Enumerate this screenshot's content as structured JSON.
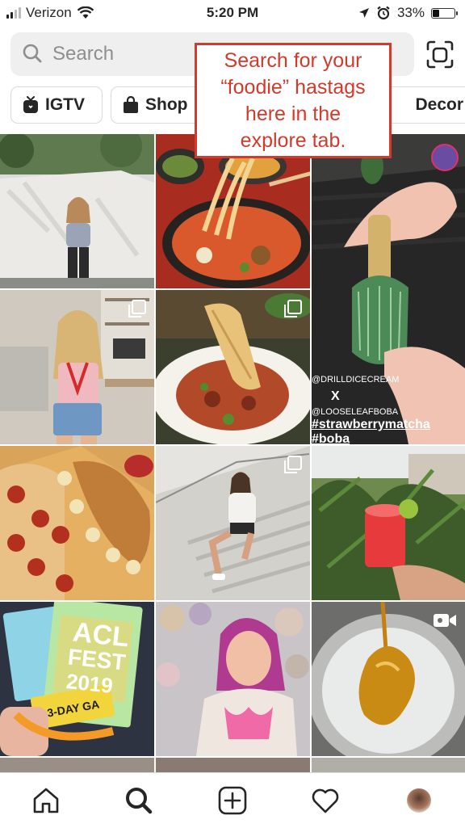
{
  "status_bar": {
    "carrier": "Verizon",
    "time": "5:20 PM",
    "battery": "33%",
    "battery_level": 0.33
  },
  "search": {
    "placeholder": "Search"
  },
  "chips": [
    {
      "label": "IGTV",
      "icon": "igtv-icon"
    },
    {
      "label": "Shop",
      "icon": "shopping-bag-icon"
    },
    {
      "label": "Decor"
    }
  ],
  "annotation": {
    "line1": "Search for your",
    "line2": "“foodie” hastags",
    "line3": "here in the",
    "line4": "explore tab."
  },
  "grid_posts": {
    "matcha_overlay": {
      "line1": "@DRILLDICECREAM",
      "line2": "X",
      "line3": "@LOOSELEAFBOBA",
      "line4": "#strawberrymatcha",
      "line5": "#boba"
    },
    "ticket": {
      "line1": "ACL",
      "line2": "FEST",
      "line3": "2019",
      "line4": "3-DAY GA"
    }
  },
  "bottom_nav": [
    "home-icon",
    "search-icon",
    "new-post-icon",
    "activity-heart-icon",
    "profile-avatar"
  ],
  "colors": {
    "annotation_red": "#d33a2c",
    "search_bg": "#efefef",
    "chip_border": "#dbdbdb"
  }
}
